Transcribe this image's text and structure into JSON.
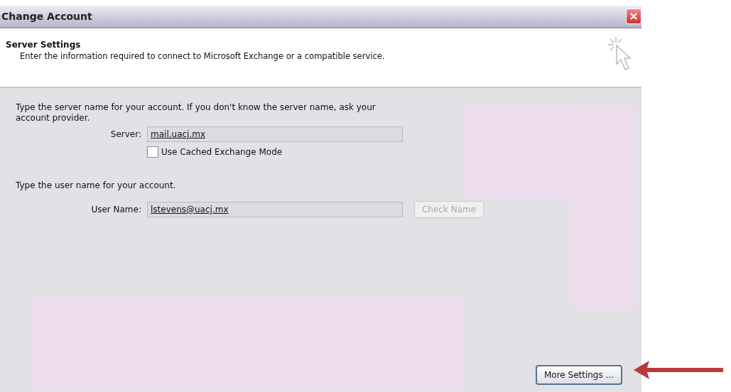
{
  "window": {
    "title": "Change Account"
  },
  "header": {
    "title": "Server Settings",
    "subtitle": "Enter the information required to connect to Microsoft Exchange or a compatible service."
  },
  "server_section": {
    "instruction": "Type the server name for your account. If you don't know the server name, ask your account provider.",
    "label": "Server:",
    "value": "mail.uacj.mx",
    "cached_mode": {
      "label": "Use Cached Exchange Mode",
      "checked": false
    }
  },
  "user_section": {
    "instruction": "Type the user name for your account.",
    "label": "User Name:",
    "value": "lstevens@uacj.mx",
    "check_button": {
      "label": "Check Name",
      "disabled": true
    }
  },
  "buttons": [
    {
      "label": "More Settings ..."
    }
  ]
}
